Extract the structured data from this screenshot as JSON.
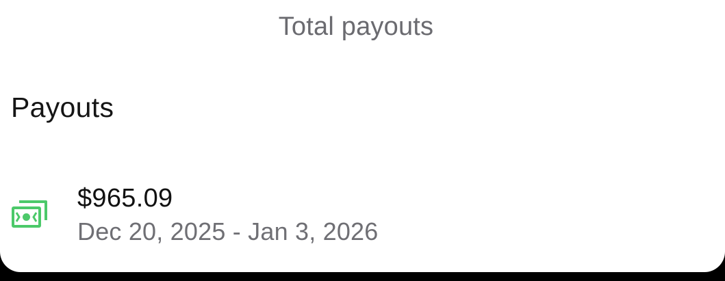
{
  "summary": {
    "label": "Total payouts"
  },
  "payouts": {
    "title": "Payouts",
    "items": [
      {
        "amount": "$965.09",
        "period": "Dec 20, 2025 - Jan 3, 2026",
        "icon": "cash-icon"
      }
    ]
  },
  "colors": {
    "icon_green": "#4cc96a",
    "caption_gray": "#6b6b70",
    "title_text": "#151515"
  }
}
